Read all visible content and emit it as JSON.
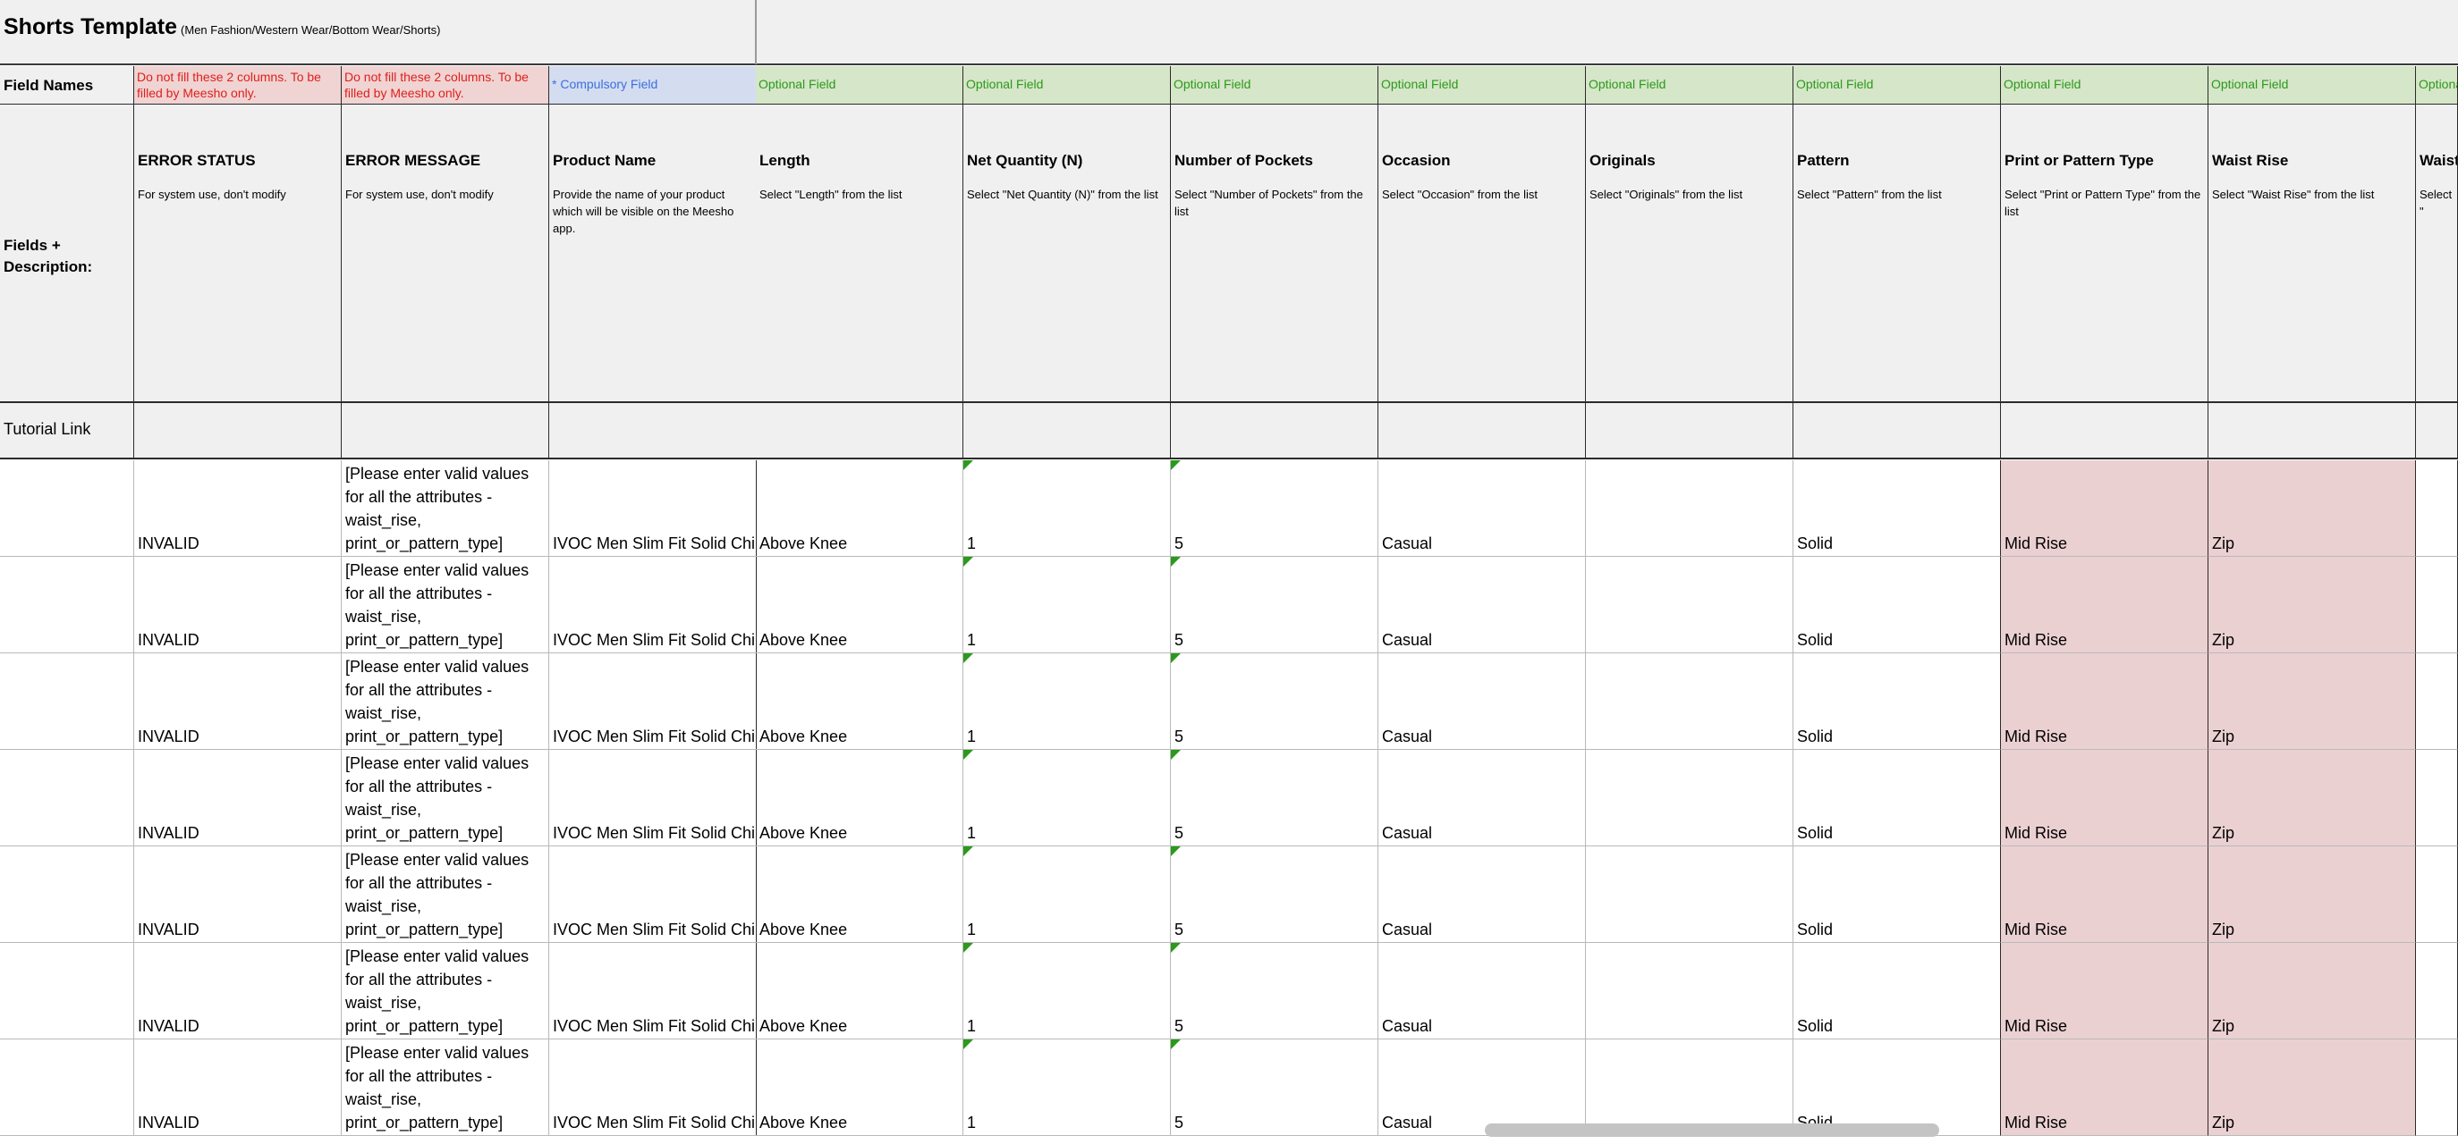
{
  "sheet": {
    "title": "Shorts Template",
    "subtitle": "(Men Fashion/Western Wear/Bottom Wear/Shorts)"
  },
  "labels": {
    "field_names": "Field Names",
    "fields_description": "Fields + Description:",
    "tutorial_link": "Tutorial Link"
  },
  "columns": [
    {
      "status": "Do not fill these 2 columns. To be filled by Meesho only.",
      "kind": "red",
      "name": "ERROR STATUS",
      "desc": "For system use, don't modify"
    },
    {
      "status": "Do not fill these 2 columns. To be filled by Meesho only.",
      "kind": "red",
      "name": "ERROR MESSAGE",
      "desc": "For system use, don't modify"
    },
    {
      "status": "* Compulsory Field",
      "kind": "blue",
      "name": "Product Name",
      "desc": "Provide the name of your product which will be visible on the Meesho app."
    },
    {
      "status": "Optional Field",
      "kind": "green",
      "name": "Length",
      "desc": "Select \"Length\" from the list"
    },
    {
      "status": "Optional Field",
      "kind": "green",
      "name": "Net Quantity (N)",
      "desc": "Select \"Net Quantity (N)\" from the list"
    },
    {
      "status": "Optional Field",
      "kind": "green",
      "name": "Number of Pockets",
      "desc": "Select \"Number of Pockets\" from the list"
    },
    {
      "status": "Optional Field",
      "kind": "green",
      "name": "Occasion",
      "desc": "Select \"Occasion\" from the list"
    },
    {
      "status": "Optional Field",
      "kind": "green",
      "name": "Originals",
      "desc": "Select \"Originals\" from the list"
    },
    {
      "status": "Optional Field",
      "kind": "green",
      "name": "Pattern",
      "desc": "Select \"Pattern\" from the list"
    },
    {
      "status": "Optional Field",
      "kind": "green",
      "name": "Print or Pattern Type",
      "desc": "Select \"Print or Pattern Type\" from the list"
    },
    {
      "status": "Optional Field",
      "kind": "green",
      "name": "Waist Rise",
      "desc": "Select \"Waist Rise\" from the list"
    },
    {
      "status": "Optiona",
      "kind": "green",
      "name": "Waist",
      "desc": "Select \""
    }
  ],
  "rows": [
    [
      "INVALID",
      "[Please enter valid values for all the attributes - waist_rise, print_or_pattern_type]",
      "IVOC Men Slim Fit Solid Chin",
      "Above Knee",
      "1",
      "5",
      "Casual",
      "",
      "Solid",
      "Mid Rise",
      "Zip",
      ""
    ],
    [
      "INVALID",
      "[Please enter valid values for all the attributes - waist_rise, print_or_pattern_type]",
      "IVOC Men Slim Fit Solid Chin",
      "Above Knee",
      "1",
      "5",
      "Casual",
      "",
      "Solid",
      "Mid Rise",
      "Zip",
      ""
    ],
    [
      "INVALID",
      "[Please enter valid values for all the attributes - waist_rise, print_or_pattern_type]",
      "IVOC Men Slim Fit Solid Chin",
      "Above Knee",
      "1",
      "5",
      "Casual",
      "",
      "Solid",
      "Mid Rise",
      "Zip",
      ""
    ],
    [
      "INVALID",
      "[Please enter valid values for all the attributes - waist_rise, print_or_pattern_type]",
      "IVOC Men Slim Fit Solid Chin",
      "Above Knee",
      "1",
      "5",
      "Casual",
      "",
      "Solid",
      "Mid Rise",
      "Zip",
      ""
    ],
    [
      "INVALID",
      "[Please enter valid values for all the attributes - waist_rise, print_or_pattern_type]",
      "IVOC Men Slim Fit Solid Chin",
      "Above Knee",
      "1",
      "5",
      "Casual",
      "",
      "Solid",
      "Mid Rise",
      "Zip",
      ""
    ],
    [
      "INVALID",
      "[Please enter valid values for all the attributes - waist_rise, print_or_pattern_type]",
      "IVOC Men Slim Fit Solid Chin",
      "Above Knee",
      "1",
      "5",
      "Casual",
      "",
      "Solid",
      "Mid Rise",
      "Zip",
      ""
    ],
    [
      "INVALID",
      "[Please enter valid values for all the attributes - waist_rise, print_or_pattern_type]",
      "IVOC Men Slim Fit Solid Chin",
      "Above Knee",
      "1",
      "5",
      "Casual",
      "",
      "Solid",
      "Mid Rise",
      "Zip",
      ""
    ]
  ],
  "colors": {
    "error_red": "#e0201b",
    "compulsory_blue": "#3b6fe0",
    "optional_green": "#2a9a1c",
    "invalid_cell_pink": "#ebd0d2",
    "header_gray": "#f0f0f0"
  }
}
